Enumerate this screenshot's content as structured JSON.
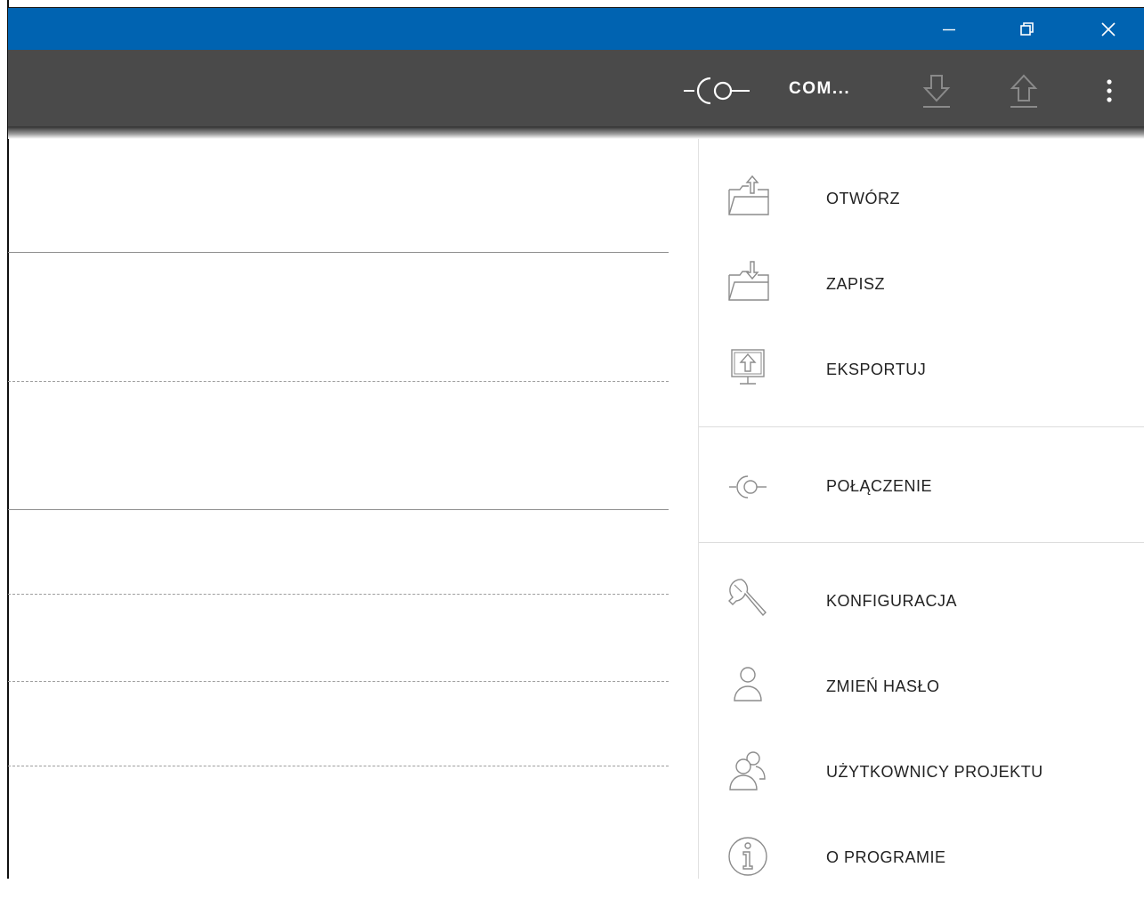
{
  "window": {
    "controls": {
      "minimize": "minimize-icon",
      "restore": "restore-icon",
      "close": "close-icon"
    },
    "titlebar_color": "#0063b1"
  },
  "toolbar": {
    "background": "#4a4a4a",
    "connection_label": "COM...",
    "icons": [
      "connection-icon",
      "download-icon",
      "upload-icon",
      "more-vertical-icon"
    ]
  },
  "menu": {
    "groups": [
      {
        "items": [
          {
            "label": "OTWÓRZ",
            "icon": "folder-open-icon"
          },
          {
            "label": "ZAPISZ",
            "icon": "folder-save-icon"
          },
          {
            "label": "EKSPORTUJ",
            "icon": "export-icon"
          }
        ]
      },
      {
        "items": [
          {
            "label": "POŁĄCZENIE",
            "icon": "connection-icon"
          }
        ]
      },
      {
        "items": [
          {
            "label": "KONFIGURACJA",
            "icon": "wrench-icon"
          },
          {
            "label": "ZMIEŃ HASŁO",
            "icon": "user-icon"
          },
          {
            "label": "UŻYTKOWNICY PROJEKTU",
            "icon": "users-icon"
          },
          {
            "label": "O PROGRAMIE",
            "icon": "info-icon"
          }
        ]
      }
    ]
  }
}
